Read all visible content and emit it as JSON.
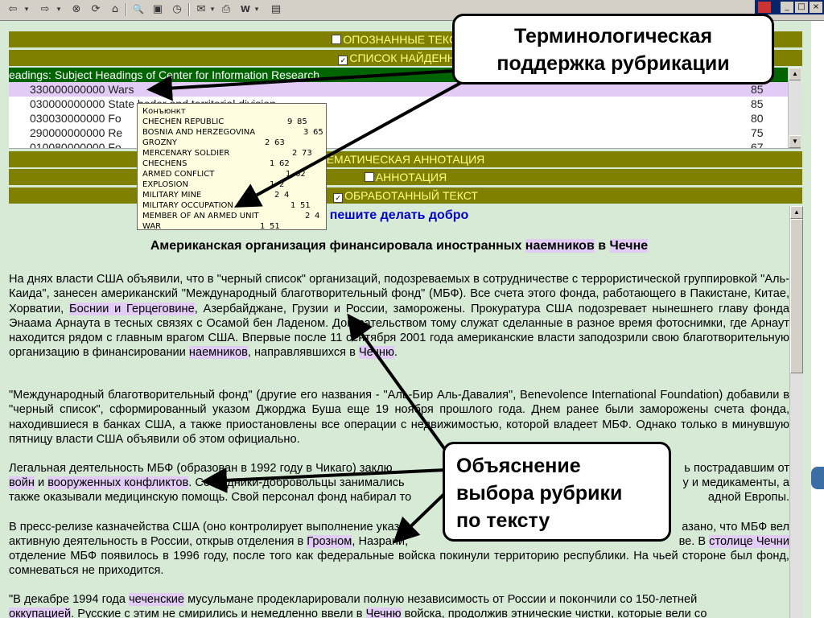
{
  "toolbar": {
    "back": "⇦",
    "forward": "⇨",
    "stop": "⊗",
    "refresh": "⟳",
    "home": "⌂",
    "search": "🔍",
    "favorites": "▣",
    "history": "◷",
    "mail": "✉",
    "print": "⎙",
    "edit": "W",
    "discuss": "▤",
    "dropdown": "▾"
  },
  "window": {
    "minimize": "_",
    "maximize": "□",
    "close": "×"
  },
  "sections": {
    "recognized_texts": "ОПОЗНАННЫЕ ТЕКСТОВ",
    "found_list": "СПИСОК НАЙДЕННЫХ",
    "thematic_annotation": "ЕМАТИЧЕСКАЯ АННОТАЦИЯ",
    "annotation": "АННОТАЦИЯ",
    "processed_text": "ОБРАБОТАННЫЙ ТЕКСТ",
    "check": "✓"
  },
  "list": {
    "header": "eadings: Subject Headings of Center for Information Research",
    "rows": [
      {
        "code": "330000000000 Wars",
        "score": "85"
      },
      {
        "code": "030000000000 State boder and territorial division",
        "score": "85"
      },
      {
        "code": "030030000000 Fo",
        "score": "80"
      },
      {
        "code": "290000000000 Re",
        "score": "75"
      },
      {
        "code": "010080000000 Fo",
        "score": "67"
      }
    ]
  },
  "popup": {
    "title": "Конъюнкт",
    "rows": [
      {
        "term": "CHECHEN REPUBLIC",
        "a": "9",
        "b": "85"
      },
      {
        "term": "BOSNIA AND HERZEGOVINA",
        "a": "3",
        "b": "65"
      },
      {
        "term": "GROZNY",
        "a": "2",
        "b": "63"
      },
      {
        "term": "MERCENARY SOLDIER",
        "a": "2",
        "b": "73"
      },
      {
        "term": "CHECHENS",
        "a": "1",
        "b": "62"
      },
      {
        "term": "ARMED CONFLICT",
        "a": "1",
        "b": "62"
      },
      {
        "term": "EXPLOSION",
        "a": "1",
        "b": "2"
      },
      {
        "term": "MILITARY MINE",
        "a": "2",
        "b": "4"
      },
      {
        "term": "MILITARY OCCUPATION",
        "a": "1",
        "b": "51"
      },
      {
        "term": "MEMBER OF AN ARMED UNIT",
        "a": "2",
        "b": "4"
      },
      {
        "term": "WAR",
        "a": "1",
        "b": "51"
      }
    ]
  },
  "doc": {
    "slogan": "пешите делать добро",
    "title_a": "Американская организация финансировала иностранных ",
    "title_hl1": "наемников",
    "title_b": " в ",
    "title_hl2": "Чечне",
    "p1": {
      "s1": "На днях власти США объявили, что в \"черный список\" организаций, подозреваемых в сотрудничестве с террористической группировкой \"Аль-Каида\", занесен американский \"Международный благотворительный фонд\" (МБФ). Все счета этого фонда, работающего в Пакистане, Китае, Хорватии, ",
      "hl1": "Боснии и Герцеговине",
      "s2": ", Азербайджане, Грузии и России, заморожены. Прокуратура США подозревает нынешнего главу фонда Энаама Арнаута в тесных связях с Осамой бен Ладеном. Доказательством тому служат сделанные в разное время фотоснимки, где Арнаут находится рядом с главным врагом США. Впервые после 11 сентября 2001 года американские власти заподозрили свою благотворительную организацию в финансировании ",
      "hl2": "наемников",
      "s3": ", направлявшихся в ",
      "hl3": "Чечню",
      "s4": "."
    },
    "p2": "\"Международный благотворительный фонд\" (другие его названия - \"Аль-Бир Аль-Давалия\", Benevolence International Foundation) добавили в \"черный список\", сформированный указом Джорджа Буша еще 19 ноября прошлого года. Днем ранее были заморожены счета фонда, находившиеся в банках США, а также приостановлены все операции с недвижимостью, которой владеет МБФ. Однако только в минувшую пятницу власти США объявили об этом официально.",
    "p3": {
      "l1a": "Легальная деятельность МБФ (образован в 1992 году в Чикаго) заклю",
      "l1b": "ь пострадавшим от",
      "hl1": "войн",
      "l2a": " и ",
      "hl2": "вооруженных конфликтов",
      "l2b": ". Сотрудники-добровольцы занимались",
      "l2c": "у и медикаменты, а",
      "l3a": "также оказывали медицинскую помощь. Свой персонал фонд набирал то",
      "l3b": "адной Европы."
    },
    "p4": {
      "l1a": "В пресс-релизе казначейства США (оно контролирует выполнение указа",
      "l1b": "азано, что МБФ вел",
      "l2a": "активную деятельность в России, открыв отделения в ",
      "hl1": "Грозном",
      "l2b": ", Назрани,",
      "l2c": "ве. В ",
      "hl2": "столице Чечни",
      "l3": "отделение МБФ появилось в 1996 году, после того как федеральные войска покинули территорию республики. На чьей стороне был фонд, сомневаться не приходится."
    },
    "p5": {
      "l1a": "\"В декабре 1994 года ",
      "hl1": "чеченские",
      "l1b": " мусульмане продекларировали полную независимость от России и покончили со 150-летней",
      "hl2": "оккупацией",
      "l2a": ". Русские с этим не смирились и немедленно ввели в ",
      "hl3": "Чечню",
      "l2b": " войска, продолжив этнические чистки, которые вели со"
    }
  },
  "callouts": {
    "top_line1": "Терминологическая",
    "top_line2": "поддержка рубрикации",
    "bottom_line1": "Объяснение",
    "bottom_line2": "выбора рубрики",
    "bottom_line3": "по тексту"
  }
}
